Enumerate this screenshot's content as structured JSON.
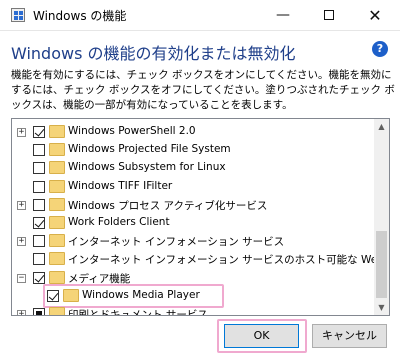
{
  "window": {
    "title": "Windows の機能",
    "min_glyph": "—",
    "close_glyph": "✕"
  },
  "heading": "Windows の機能の有効化または無効化",
  "help_glyph": "?",
  "description": "機能を有効にするには、チェック ボックスをオンにしてください。機能を無効にするには、チェック ボックスをオフにしてください。塗りつぶされたチェック ボックスは、機能の一部が有効になっていることを表します。",
  "features": [
    {
      "label": "Windows PowerShell 2.0",
      "state": "checked",
      "expander": "plus"
    },
    {
      "label": "Windows Projected File System",
      "state": "unchecked",
      "expander": "none"
    },
    {
      "label": "Windows Subsystem for Linux",
      "state": "unchecked",
      "expander": "none"
    },
    {
      "label": "Windows TIFF IFilter",
      "state": "unchecked",
      "expander": "none"
    },
    {
      "label": "Windows プロセス アクティブ化サービス",
      "state": "unchecked",
      "expander": "plus"
    },
    {
      "label": "Work Folders Client",
      "state": "checked",
      "expander": "none"
    },
    {
      "label": "インターネット インフォメーション サービス",
      "state": "unchecked",
      "expander": "plus"
    },
    {
      "label": "インターネット インフォメーション サービスのホスト可能な Web コア",
      "state": "unchecked",
      "expander": "none"
    },
    {
      "label": "メディア機能",
      "state": "checked",
      "expander": "minus"
    },
    {
      "label": "Windows Media Player",
      "state": "checked",
      "expander": "none",
      "child": true,
      "highlighted": true
    },
    {
      "label": "印刷とドキュメント サービス",
      "state": "partial",
      "expander": "plus"
    }
  ],
  "expander_glyphs": {
    "plus": "+",
    "minus": "−"
  },
  "scroll_glyphs": {
    "up": "▲",
    "down": "▼"
  },
  "buttons": {
    "ok": "OK",
    "cancel": "キャンセル"
  },
  "colors": {
    "heading": "#1f3f8a",
    "highlight": "#f0a9cf",
    "folder": "#f5d478"
  }
}
